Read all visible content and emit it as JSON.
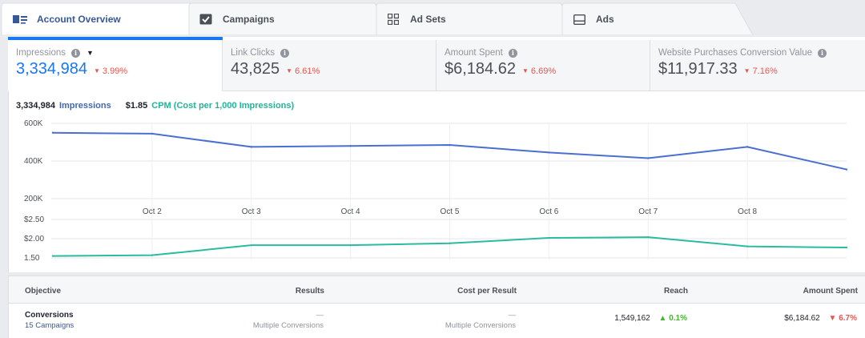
{
  "tabs": [
    {
      "label": "Account Overview",
      "icon": "account-overview-icon",
      "active": true
    },
    {
      "label": "Campaigns",
      "icon": "campaigns-icon",
      "active": false
    },
    {
      "label": "Ad Sets",
      "icon": "ad-sets-icon",
      "active": false
    },
    {
      "label": "Ads",
      "icon": "ads-icon",
      "active": false
    }
  ],
  "metrics": [
    {
      "label": "Impressions",
      "value": "3,334,984",
      "delta": "3.99%",
      "selected": true
    },
    {
      "label": "Link Clicks",
      "value": "43,825",
      "delta": "6.61%",
      "selected": false
    },
    {
      "label": "Amount Spent",
      "value": "$6,184.62",
      "delta": "6.69%",
      "selected": false
    },
    {
      "label": "Website Purchases Conversion Value",
      "value": "$11,917.33",
      "delta": "7.16%",
      "selected": false
    }
  ],
  "legend": {
    "impressions_value": "3,334,984",
    "impressions_label": "Impressions",
    "cpm_value": "$1.85",
    "cpm_label": "CPM (Cost per 1,000 Impressions)"
  },
  "chart_data": {
    "type": "line",
    "x": [
      "",
      "Oct 2",
      "Oct 3",
      "Oct 4",
      "Oct 5",
      "Oct 6",
      "Oct 7",
      "Oct 8",
      ""
    ],
    "x_tick_labels": [
      "Oct 2",
      "Oct 3",
      "Oct 4",
      "Oct 5",
      "Oct 6",
      "Oct 7",
      "Oct 8"
    ],
    "top": {
      "yticks": [
        "600K",
        "400K",
        "200K"
      ],
      "ylim": [
        200000,
        600000
      ],
      "series": [
        {
          "name": "Impressions",
          "color": "#4a6fd1",
          "values": [
            550000,
            545000,
            475000,
            480000,
            485000,
            445000,
            415000,
            475000,
            355000
          ]
        }
      ]
    },
    "bottom": {
      "yticks": [
        "$2.50",
        "$2.00",
        "1.50"
      ],
      "ylim": [
        1.5,
        2.5
      ],
      "series": [
        {
          "name": "CPM (Cost per 1,000 Impressions)",
          "color": "#2bbba0",
          "values": [
            1.55,
            1.57,
            1.83,
            1.83,
            1.88,
            2.02,
            2.04,
            1.8,
            1.77
          ]
        }
      ]
    }
  },
  "table": {
    "headers": {
      "objective": "Objective",
      "results": "Results",
      "cost": "Cost per Result",
      "reach": "Reach",
      "spent": "Amount Spent"
    },
    "row": {
      "objective": "Conversions",
      "campaigns": "15 Campaigns",
      "results_dash": "—",
      "results_sub": "Multiple Conversions",
      "cost_dash": "—",
      "cost_sub": "Multiple Conversions",
      "reach": "1,549,162",
      "reach_delta": "0.1%",
      "spent": "$6,184.62",
      "spent_delta": "6.7%"
    }
  }
}
